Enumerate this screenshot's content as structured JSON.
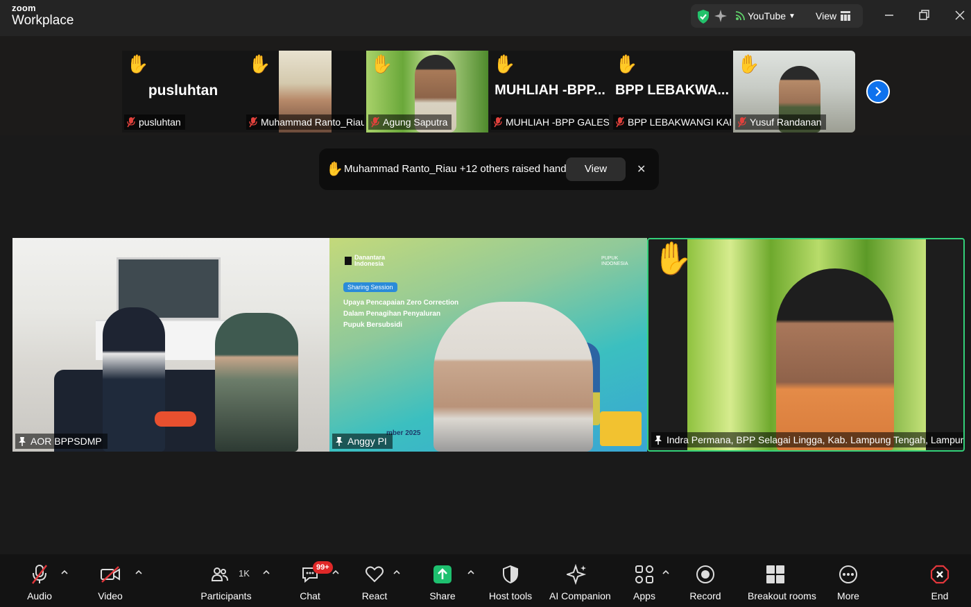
{
  "app": {
    "brand_top": "zoom",
    "brand_bottom": "Workplace"
  },
  "titlebar": {
    "youtube_label": "YouTube",
    "view_label": "View"
  },
  "strip_tiles": [
    {
      "big_text": "pusluhtan",
      "name": "pusluhtan"
    },
    {
      "big_text": "",
      "name": "Muhammad Ranto_Riau"
    },
    {
      "big_text": "",
      "name": "Agung Saputra"
    },
    {
      "big_text": "MUHLIAH -BPP...",
      "name": "MUHLIAH -BPP GALES..."
    },
    {
      "big_text": "BPP LEBAKWA...",
      "name": "BPP LEBAKWANGI KAB..."
    },
    {
      "big_text": "",
      "name": "Yusuf Randanan"
    }
  ],
  "raised_hands_banner": {
    "text": "Muhammad Ranto_Riau +12 others raised hands",
    "view_button": "View"
  },
  "videos": [
    {
      "name": "AOR BPPSDMP"
    },
    {
      "name": "Anggy PI",
      "slide": {
        "brand": "Danantara Indonesia",
        "tag": "Sharing Session",
        "title_1": "Upaya Pencapaian Zero Correction",
        "title_2": "Dalam Penagihan Penyaluran",
        "title_3": "Pupuk Bersubsidi",
        "date": "mber 2025",
        "logo": "PUPUK INDONESIA"
      }
    },
    {
      "name": "Indra Permana, BPP Selagai Lingga, Kab. Lampung Tengah, Lampung"
    }
  ],
  "toolbar": {
    "audio": "Audio",
    "video": "Video",
    "participants": "Participants",
    "participants_count": "1K",
    "chat": "Chat",
    "chat_badge": "99+",
    "react": "React",
    "share": "Share",
    "host_tools": "Host tools",
    "ai_companion": "AI Companion",
    "apps": "Apps",
    "record": "Record",
    "breakout_rooms": "Breakout rooms",
    "more": "More",
    "end": "End"
  },
  "colors": {
    "share_green": "#1ec06f",
    "end_red": "#e3373c",
    "accent_blue": "#0e72ed",
    "active_border": "#33d17a"
  }
}
